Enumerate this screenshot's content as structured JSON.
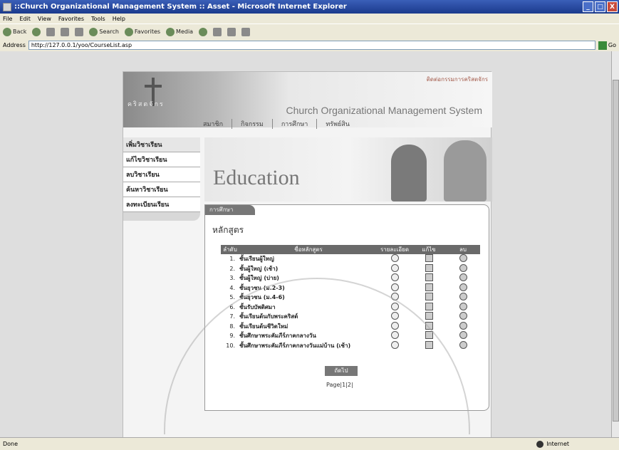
{
  "window": {
    "title": "::Church Organizational Management System :: Asset - Microsoft Internet Explorer",
    "controls": [
      "_",
      "□",
      "X"
    ]
  },
  "menubar": [
    "File",
    "Edit",
    "View",
    "Favorites",
    "Tools",
    "Help"
  ],
  "toolbar": {
    "back": "Back",
    "search": "Search",
    "favorites": "Favorites",
    "media": "Media"
  },
  "address": {
    "label": "Address",
    "url": "http://127.0.0.1/yoo/CourseList.asp",
    "go": "Go"
  },
  "status": {
    "left": "Done",
    "zone": "Internet"
  },
  "site": {
    "top_link": "ติดต่อกรรมการคริสตจักร",
    "org_thai": "คริสตจักร",
    "system_name": "Church Organizational Management System",
    "topnav": [
      "สมาชิก",
      "กิจกรรม",
      "การศึกษา",
      "ทรัพย์สิน"
    ],
    "side_menu": [
      "เพิ่มวิชาเรียน",
      "แก้ไขวิชาเรียน",
      "ลบวิชาเรียน",
      "ค้นหาวิชาเรียน",
      "ลงทะเบียนเรียน"
    ],
    "hero_title": "Education",
    "content_tab": "การศึกษา",
    "content_heading": "หลักสูตร",
    "table_headers": [
      "ลำดับ",
      "ชื่อหลักสูตร",
      "รายละเอียด",
      "แก้ไข",
      "ลบ"
    ],
    "courses": [
      {
        "no": "1.",
        "name": "ชั้นเรียนผู้ใหญ่"
      },
      {
        "no": "2.",
        "name": "ชั้นผู้ใหญ่ (เช้า)"
      },
      {
        "no": "3.",
        "name": "ชั้นผู้ใหญ่ (บ่าย)"
      },
      {
        "no": "4.",
        "name": "ชั้นยุวชน (ม.2-3)"
      },
      {
        "no": "5.",
        "name": "ชั้นยุวชน (ม.4-6)"
      },
      {
        "no": "6.",
        "name": "ชั้นรับบัพติศมา"
      },
      {
        "no": "7.",
        "name": "ชั้นเรียนต้นกับพระคริสต์"
      },
      {
        "no": "8.",
        "name": "ชั้นเรียนต้นชีวิตใหม่"
      },
      {
        "no": "9.",
        "name": "ชั้นศึกษาพระคัมภีร์ภาคกลางวัน"
      },
      {
        "no": "10.",
        "name": "ชั้นศึกษาพระคัมภีร์ภาคกลางวันแม่บ้าน (เช้า)"
      }
    ],
    "next_label": "ถัดไป",
    "pager": "Page|1|2|"
  }
}
